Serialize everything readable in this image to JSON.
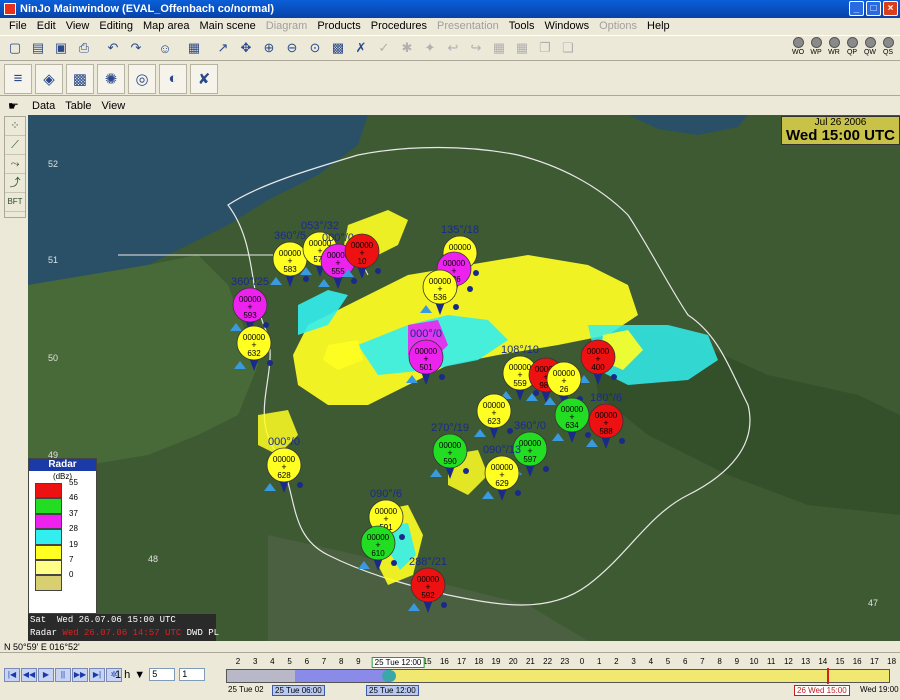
{
  "window": {
    "title": "NinJo Mainwindow  (EVAL_Offenbach co/normal)"
  },
  "menu": [
    {
      "label": "File",
      "enabled": true
    },
    {
      "label": "Edit",
      "enabled": true
    },
    {
      "label": "View",
      "enabled": true
    },
    {
      "label": "Editing",
      "enabled": true
    },
    {
      "label": "Map area",
      "enabled": true
    },
    {
      "label": "Main scene",
      "enabled": true
    },
    {
      "label": "Diagram",
      "enabled": false
    },
    {
      "label": "Products",
      "enabled": true
    },
    {
      "label": "Procedures",
      "enabled": true
    },
    {
      "label": "Presentation",
      "enabled": false
    },
    {
      "label": "Tools",
      "enabled": true
    },
    {
      "label": "Windows",
      "enabled": true
    },
    {
      "label": "Options",
      "enabled": false
    },
    {
      "label": "Help",
      "enabled": true
    }
  ],
  "layer_buttons": [
    "WO",
    "WP",
    "WR",
    "QP",
    "QW",
    "QS"
  ],
  "subbar": {
    "data": "Data",
    "table": "Table",
    "view": "View"
  },
  "left_tools": {
    "bft": "BFT"
  },
  "map": {
    "date": "Jul 26 2006",
    "time": "Wed 15:00 UTC",
    "lat_labels": [
      "52",
      "51",
      "50",
      "49",
      "48",
      "47"
    ]
  },
  "legend": {
    "title": "Radar",
    "unit": "(dBz)",
    "levels": [
      {
        "value": "55",
        "color": "#ee1111"
      },
      {
        "value": "46",
        "color": "#22dd22"
      },
      {
        "value": "37",
        "color": "#ee22ee"
      },
      {
        "value": "28",
        "color": "#33eeee"
      },
      {
        "value": "19",
        "color": "#ffff22"
      },
      {
        "value": "7",
        "color": "#ffff88"
      },
      {
        "value": "0",
        "color": "#d8d070"
      }
    ]
  },
  "infobar": {
    "line1_label": "Sat",
    "line1_value": "Wed 26.07.06 15:00 UTC",
    "line2_label": "Radar",
    "line2_value": "Wed 26.07.06 14:57 UTC",
    "line2_source": "DWD PL"
  },
  "coords": "N 50°59' E 016°52'",
  "stations": [
    {
      "head": "360°/5",
      "mid": "00000",
      "low": "583",
      "color": "#ffff22"
    },
    {
      "head": "053°/32",
      "mid": "00000",
      "low": "576",
      "color": "#ffff22"
    },
    {
      "head": "000°/0",
      "mid": "00000",
      "low": "555",
      "color": "#ee22ee"
    },
    {
      "head": "",
      "mid": "00000",
      "low": "10",
      "color": "#ee1111"
    },
    {
      "head": "135°/18",
      "mid": "00000",
      "low": "300",
      "color": "#ffff22"
    },
    {
      "head": "",
      "mid": "00000",
      "low": "626",
      "color": "#ee22ee"
    },
    {
      "head": "",
      "mid": "00000",
      "low": "536",
      "color": "#ffff22"
    },
    {
      "head": "360°/25",
      "mid": "00000",
      "low": "593",
      "color": "#ee22ee"
    },
    {
      "head": "",
      "mid": "00000",
      "low": "632",
      "color": "#ffff22"
    },
    {
      "head": "000°/0",
      "mid": "00000",
      "low": "501",
      "color": "#ee22ee"
    },
    {
      "head": "",
      "mid": "00000",
      "low": "400",
      "color": "#ee1111"
    },
    {
      "head": "108°/10",
      "mid": "00000",
      "low": "559",
      "color": "#ffff22"
    },
    {
      "head": "",
      "mid": "00000",
      "low": "986",
      "color": "#ee1111"
    },
    {
      "head": "",
      "mid": "00000",
      "low": "26",
      "color": "#ffff22"
    },
    {
      "head": "",
      "mid": "00000",
      "low": "623",
      "color": "#ffff22"
    },
    {
      "head": "",
      "mid": "00000",
      "low": "634",
      "color": "#22dd22"
    },
    {
      "head": "180°/6",
      "mid": "00000",
      "low": "588",
      "color": "#ee1111"
    },
    {
      "head": "270°/19",
      "mid": "00000",
      "low": "590",
      "color": "#22dd22"
    },
    {
      "head": "360°/0",
      "mid": "00000",
      "low": "597",
      "color": "#22dd22"
    },
    {
      "head": "090°/13",
      "mid": "00000",
      "low": "629",
      "color": "#ffff22"
    },
    {
      "head": "000°/0",
      "mid": "00000",
      "low": "628",
      "color": "#ffff22"
    },
    {
      "head": "090°/6",
      "mid": "00000",
      "low": "591",
      "color": "#ffff22"
    },
    {
      "head": "",
      "mid": "00000",
      "low": "610",
      "color": "#22dd22"
    },
    {
      "head": "288°/21",
      "mid": "00000",
      "low": "592",
      "color": "#ee1111"
    }
  ],
  "timebar": {
    "step": "1 h",
    "spin1": "5",
    "spin2": "1",
    "hours": [
      "2",
      "3",
      "4",
      "5",
      "6",
      "7",
      "8",
      "9",
      "",
      "",
      "",
      "15",
      "16",
      "17",
      "18",
      "19",
      "20",
      "21",
      "22",
      "23",
      "0",
      "1",
      "2",
      "3",
      "4",
      "5",
      "6",
      "7",
      "8",
      "9",
      "10",
      "11",
      "12",
      "13",
      "14",
      "15",
      "16",
      "17",
      "18"
    ],
    "marker_top": "25 Tue 12:00",
    "date_start": "25 Tue 02",
    "date_sel1": "25 Tue 06:00",
    "date_sel2": "25 Tue 12:00",
    "date_now": "26 Wed 15:00",
    "date_end": "Wed 19:00"
  }
}
